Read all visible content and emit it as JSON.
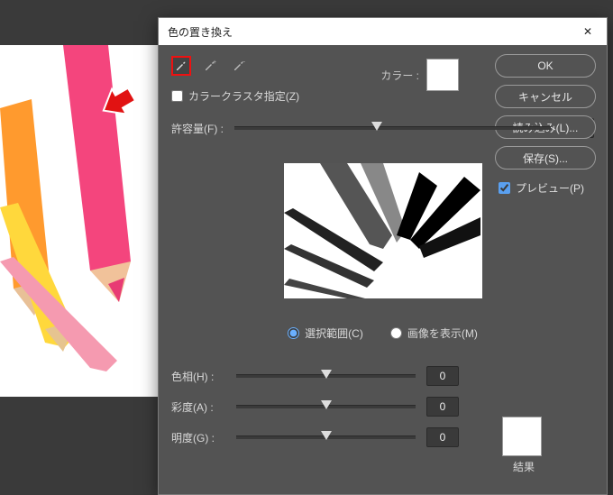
{
  "dialog": {
    "title": "色の置き換え",
    "close": "✕",
    "colorLabel": "カラー :",
    "clusterLabel": "カラークラスタ指定(Z)",
    "fuzzLabel": "許容量(F) :",
    "fuzzValue": "90",
    "radioSelection": "選択範囲(C)",
    "radioImage": "画像を表示(M)",
    "hue": {
      "label": "色相(H) :",
      "value": "0"
    },
    "sat": {
      "label": "彩度(A) :",
      "value": "0"
    },
    "lig": {
      "label": "明度(G) :",
      "value": "0"
    },
    "resultLabel": "結果"
  },
  "buttons": {
    "ok": "OK",
    "cancel": "キャンセル",
    "load": "読み込み(L)...",
    "save": "保存(S)...",
    "preview": "プレビュー(P)"
  }
}
